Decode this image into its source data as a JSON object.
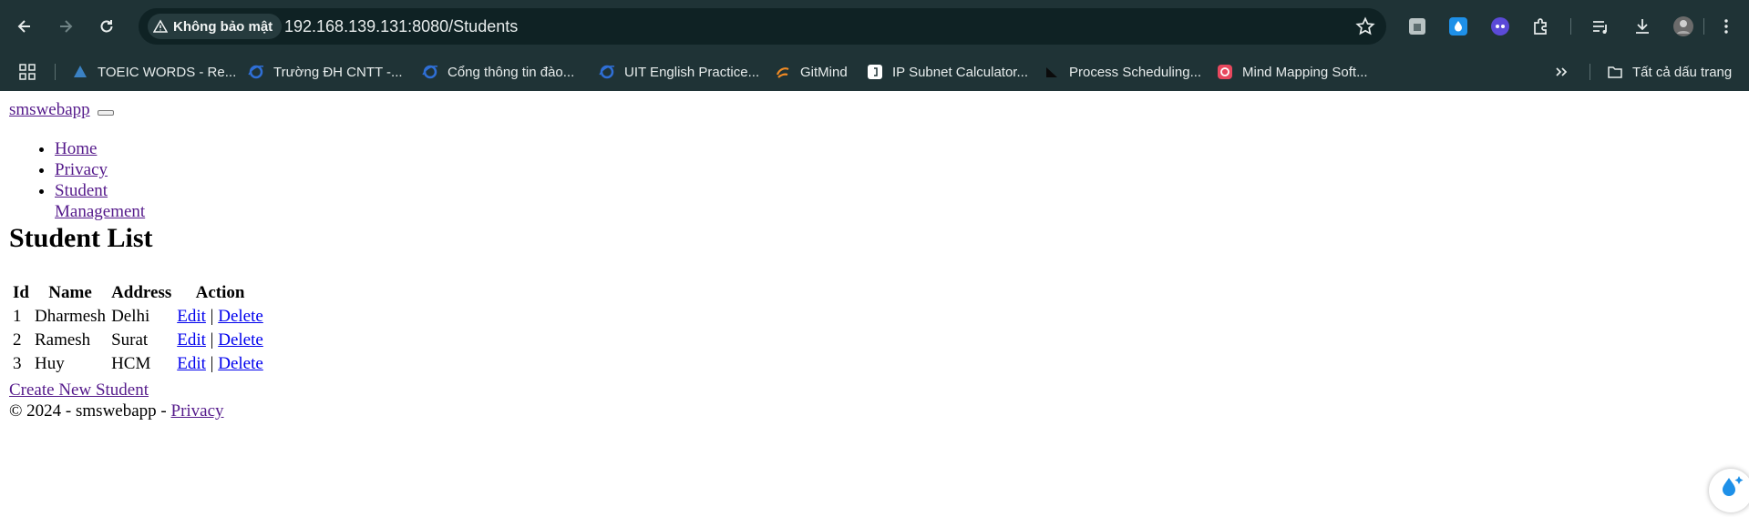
{
  "browser": {
    "security_label": "Không bảo mật",
    "url": "192.168.139.131:8080/Students",
    "bookmarks": [
      {
        "label": "TOEIC WORDS - Re...",
        "icon": "toeic-icon",
        "color": "#3b82c4"
      },
      {
        "label": "Trường ĐH CNTT -...",
        "icon": "ie-icon",
        "color": "#2f6fd6"
      },
      {
        "label": "Cổng thông tin đào...",
        "icon": "ie-icon",
        "color": "#2f6fd6"
      },
      {
        "label": "UIT English Practice...",
        "icon": "ie-icon",
        "color": "#2f6fd6"
      },
      {
        "label": "GitMind",
        "icon": "gitmind-icon",
        "color": "#f08a24"
      },
      {
        "label": "IP Subnet Calculator...",
        "icon": "doc-icon",
        "color": "#ffffff"
      },
      {
        "label": "Process Scheduling...",
        "icon": "triangle-icon",
        "color": "#111111"
      },
      {
        "label": "Mind Mapping Soft...",
        "icon": "mindmap-icon",
        "color": "#e8485e"
      }
    ],
    "all_bookmarks_label": "Tất cả dấu trang"
  },
  "page": {
    "brand": "smswebapp",
    "nav": [
      "Home",
      "Privacy",
      "Student Management"
    ],
    "title": "Student List",
    "table": {
      "headers": [
        "Id",
        "Name",
        "Address",
        "Action"
      ],
      "rows": [
        {
          "id": "1",
          "name": "Dharmesh",
          "address": "Delhi",
          "edit": "Edit",
          "sep": "|",
          "delete": "Delete"
        },
        {
          "id": "2",
          "name": "Ramesh",
          "address": "Surat",
          "edit": "Edit",
          "sep": "|",
          "delete": "Delete"
        },
        {
          "id": "3",
          "name": "Huy",
          "address": "HCM",
          "edit": "Edit",
          "sep": "|",
          "delete": "Delete"
        }
      ]
    },
    "create_link": "Create New Student",
    "footer_text": "© 2024 - smswebapp -",
    "footer_link": "Privacy"
  }
}
